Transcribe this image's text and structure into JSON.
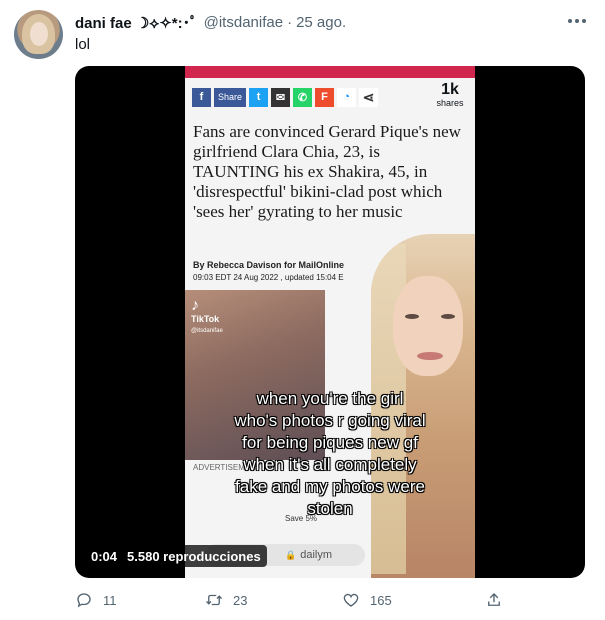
{
  "tweet": {
    "display_name": "dani fae ☽⟡✧*:･ﾟ",
    "handle": "@itsdanifae",
    "separator": "·",
    "date": "25 ago.",
    "text": "lol",
    "more_icon": "more-horizontal-icon"
  },
  "media": {
    "type": "video",
    "elapsed": "0:04",
    "views": "5.580 reproducciones",
    "article": {
      "shares_count": "1k",
      "shares_label": "shares",
      "share_label": "Share",
      "headline": "Fans are convinced Gerard Pique's new girlfriend Clara Chia, 23, is TAUNTING his ex Shakira, 45, in 'disrespectful' bikini-clad post which 'sees her' gyrating to her music",
      "byline": "By Rebecca Davison for MailOnline",
      "dateline": "09:03 EDT 24 Aug 2022 , updated 15:04 E",
      "advertisement": "ADVERTISEMENT",
      "save": "Save 5%",
      "url": "dailym",
      "tiktok": "TikTok",
      "tiktok_user": "@itsdanifae"
    },
    "caption_lines": [
      "when you're the girl",
      "who's photos r going viral",
      "for being piques new gf",
      "when it's all completely",
      "fake and my photos were",
      "stolen"
    ]
  },
  "actions": {
    "reply": {
      "icon": "reply-icon",
      "count": "11"
    },
    "retweet": {
      "icon": "retweet-icon",
      "count": "23"
    },
    "like": {
      "icon": "heart-icon",
      "count": "165"
    },
    "share": {
      "icon": "share-icon"
    }
  },
  "colors": {
    "text_primary": "#0f1419",
    "text_secondary": "#536471",
    "media_bg": "#000000"
  }
}
